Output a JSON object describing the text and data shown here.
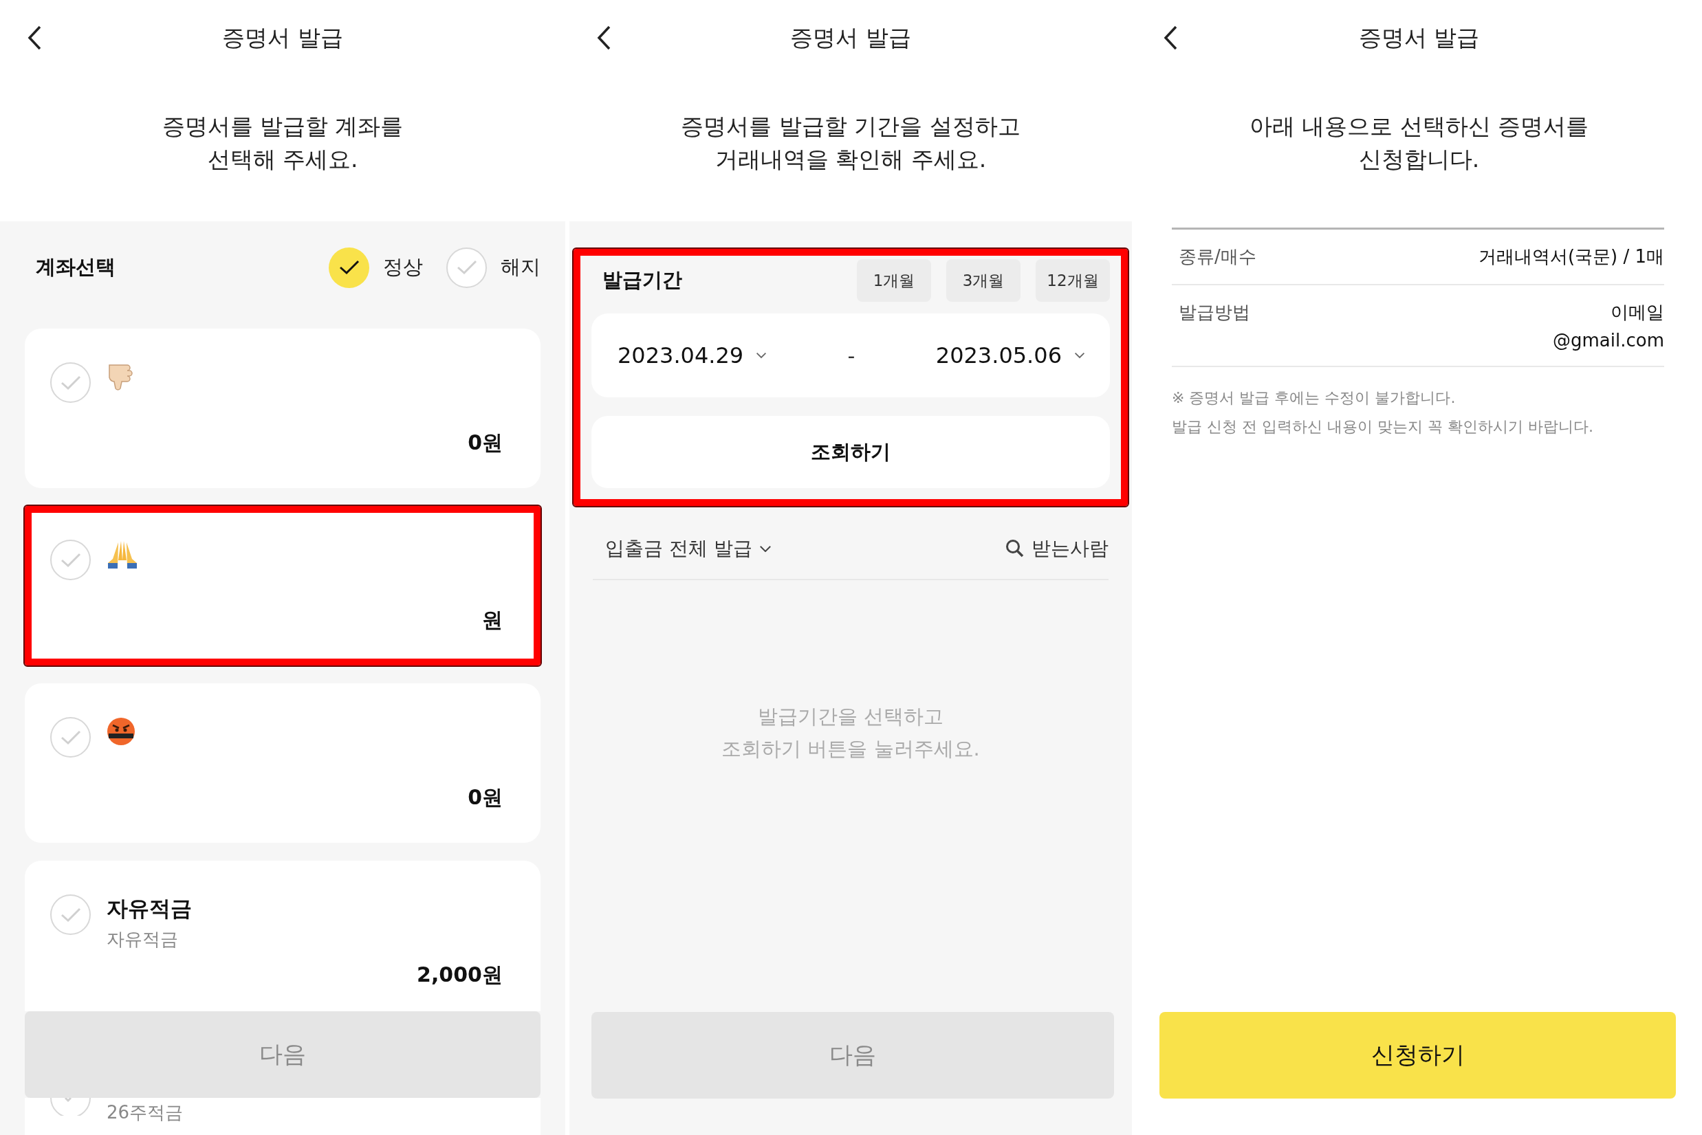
{
  "screens": [
    {
      "kind": "accounts",
      "title": "증명서 발급",
      "subtitle": [
        "증명서를 발급할 계좌를",
        "선택해 주세요."
      ],
      "section_title": "계좌선택",
      "filters": [
        {
          "label": "정상",
          "selected": true
        },
        {
          "label": "해지",
          "selected": false
        }
      ],
      "accounts": [
        {
          "kind": "emoji",
          "selected": false,
          "highlighted": false,
          "amount": "0원"
        },
        {
          "kind": "emoji",
          "selected": false,
          "highlighted": true,
          "amount": "원"
        },
        {
          "kind": "emoji",
          "selected": false,
          "highlighted": false,
          "amount": "0원"
        },
        {
          "kind": "named",
          "selected": false,
          "highlighted": false,
          "name": "자유적금",
          "subtitle": "자유적금",
          "amount": "2,000원"
        },
        {
          "kind": "cut",
          "selected": false,
          "subtitle": "26주적금"
        }
      ],
      "button": {
        "label": "다음",
        "disabled": true
      }
    },
    {
      "kind": "period",
      "title": "증명서 발급",
      "subtitle": [
        "증명서를 발급할 기간을 설정하고",
        "거래내역을 확인해 주세요."
      ],
      "period": {
        "label": "발급기간",
        "highlighted": true,
        "presets": [
          "1개월",
          "3개월",
          "12개월"
        ],
        "from": "2023.04.29",
        "separator": "-",
        "to": "2023.05.06",
        "query": "조회하기"
      },
      "filter": "입출금 전체 발급",
      "search": "받는사람",
      "empty": [
        "발급기간을 선택하고",
        "조회하기 버튼을 눌러주세요."
      ],
      "button": {
        "label": "다음",
        "disabled": true
      }
    },
    {
      "kind": "confirm",
      "title": "증명서 발급",
      "subtitle": [
        "아래 내용으로 선택하신 증명서를",
        "신청합니다."
      ],
      "rows": [
        {
          "label": "종류/매수",
          "values": [
            "거래내역서(국문) / 1매"
          ]
        },
        {
          "label": "발급방법",
          "values": [
            "이메일",
            "@gmail.com"
          ]
        }
      ],
      "notes": [
        "※ 증명서 발급 후에는 수정이 불가합니다.",
        "발급 신청 전 입력하신 내용이 맞는지 꼭 확인하시기 바랍니다."
      ],
      "button": {
        "label": "신청하기",
        "disabled": false
      }
    }
  ]
}
